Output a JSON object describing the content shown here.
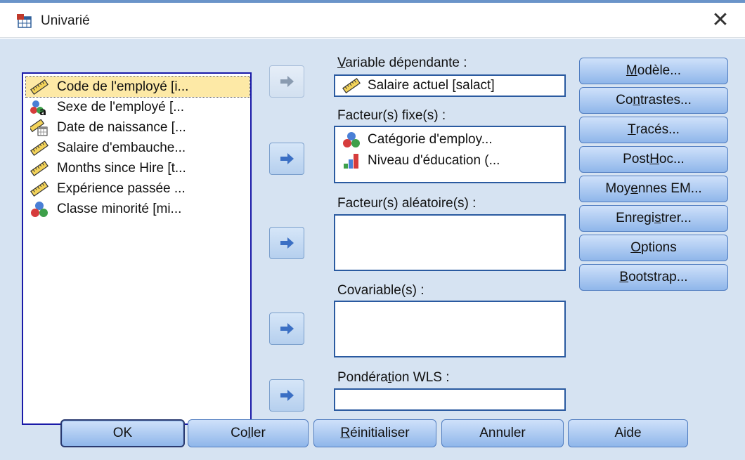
{
  "window": {
    "title": "Univarié",
    "close_glyph": "✕"
  },
  "source_variables": [
    {
      "label": "Code de l'employé [i...",
      "icon": "scale-ruler-icon",
      "selected": true
    },
    {
      "label": "Sexe de l'employé [...",
      "icon": "nominal-string-icon",
      "selected": false
    },
    {
      "label": "Date de naissance [...",
      "icon": "date-scale-icon",
      "selected": false
    },
    {
      "label": "Salaire d'embauche...",
      "icon": "scale-ruler-icon",
      "selected": false
    },
    {
      "label": "Months since Hire [t...",
      "icon": "scale-ruler-icon",
      "selected": false
    },
    {
      "label": "Expérience passée ...",
      "icon": "scale-ruler-icon",
      "selected": false
    },
    {
      "label": "Classe minorité [mi...",
      "icon": "nominal-icon",
      "selected": false
    }
  ],
  "dependent": {
    "label_u": "V",
    "label_rest": "ariable dépendante :",
    "value": "Salaire actuel [salact]",
    "icon": "scale-ruler-icon"
  },
  "fixed_factors": {
    "label": "Facteur(s) fixe(s) :",
    "items": [
      {
        "label": "Catégorie d'employ...",
        "icon": "nominal-icon"
      },
      {
        "label": "Niveau d'éducation (...",
        "icon": "ordinal-bar-icon"
      }
    ]
  },
  "random_factors": {
    "label": "Facteur(s) aléatoire(s) :"
  },
  "covariates": {
    "label": "Covariable(s) :"
  },
  "wls": {
    "label_pre": "Pondéra",
    "label_u": "t",
    "label_post": "ion WLS :"
  },
  "side_buttons": [
    {
      "pre": "",
      "u": "M",
      "post": "odèle..."
    },
    {
      "pre": "Co",
      "u": "n",
      "post": "trastes..."
    },
    {
      "pre": "",
      "u": "T",
      "post": "racés..."
    },
    {
      "pre": "Post ",
      "u": "H",
      "post": "oc..."
    },
    {
      "pre": "Moy",
      "u": "e",
      "post": "nnes EM..."
    },
    {
      "pre": "Enregi",
      "u": "s",
      "post": "trer..."
    },
    {
      "pre": "",
      "u": "O",
      "post": "ptions"
    },
    {
      "pre": "",
      "u": "B",
      "post": "ootstrap..."
    }
  ],
  "bottom_buttons": [
    {
      "pre": "OK",
      "u": "",
      "post": ""
    },
    {
      "pre": "Co",
      "u": "l",
      "post": "ler"
    },
    {
      "pre": "",
      "u": "R",
      "post": "éinitialiser"
    },
    {
      "pre": "Annuler",
      "u": "",
      "post": ""
    },
    {
      "pre": "Aide",
      "u": "",
      "post": ""
    }
  ],
  "colors": {
    "dialog_bg": "#d6e3f2",
    "button_top": "#cfe1fa",
    "button_bottom": "#8fb6ea",
    "arrow_fill": "#3b6fc4",
    "selection": "#fde9a6"
  }
}
